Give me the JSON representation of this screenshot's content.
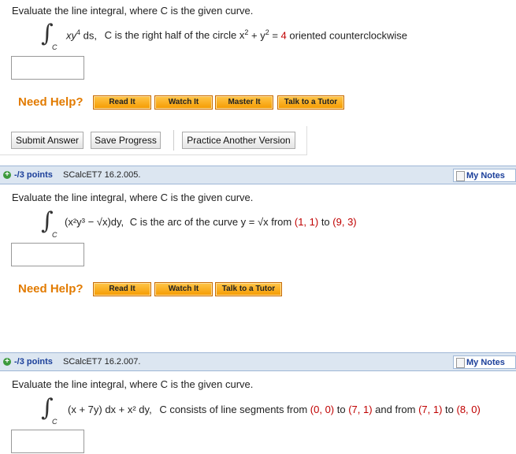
{
  "q1": {
    "prompt": "Evaluate the line integral, where C is the given curve.",
    "subscript": "C",
    "integrand_a": "xy",
    "integrand_exp": "4",
    "integrand_b": " ds,",
    "condition": "C  is the right half of the circle  x",
    "exp2a": "2",
    "plus": " + y",
    "exp2b": "2",
    "eq": " = ",
    "rhs": "4",
    "tail": "  oriented counterclockwise",
    "need_help": "Need Help?",
    "buttons": [
      "Read It",
      "Watch It",
      "Master It",
      "Talk to a Tutor"
    ],
    "actions": [
      "Submit Answer",
      "Save Progress",
      "Practice Another Version"
    ]
  },
  "q2": {
    "points": "-/3 points",
    "code": "SCalcET7 16.2.005.",
    "my_notes": "My Notes",
    "prompt": "Evaluate the line integral, where C is the given curve.",
    "subscript": "C",
    "integrand": "(x²y³ − √x)dy,",
    "condition": "C  is the arc of the curve  y = √x  from ",
    "p1": "(1, 1)",
    "to": " to ",
    "p2": "(9, 3)",
    "need_help": "Need Help?",
    "buttons": [
      "Read It",
      "Watch It",
      "Talk to a Tutor"
    ]
  },
  "q3": {
    "points": "-/3 points",
    "code": "SCalcET7 16.2.007.",
    "my_notes": "My Notes",
    "prompt": "Evaluate the line integral, where C is the given curve.",
    "subscript": "C",
    "integrand": "(x + 7y) dx + x² dy,",
    "condition": "C  consists of line segments from ",
    "p1": "(0, 0)",
    "to1": " to ",
    "p2": "(7, 1)",
    "and": " and from ",
    "p3": "(7, 1)",
    "to2": " to ",
    "p4": "(8, 0)"
  }
}
